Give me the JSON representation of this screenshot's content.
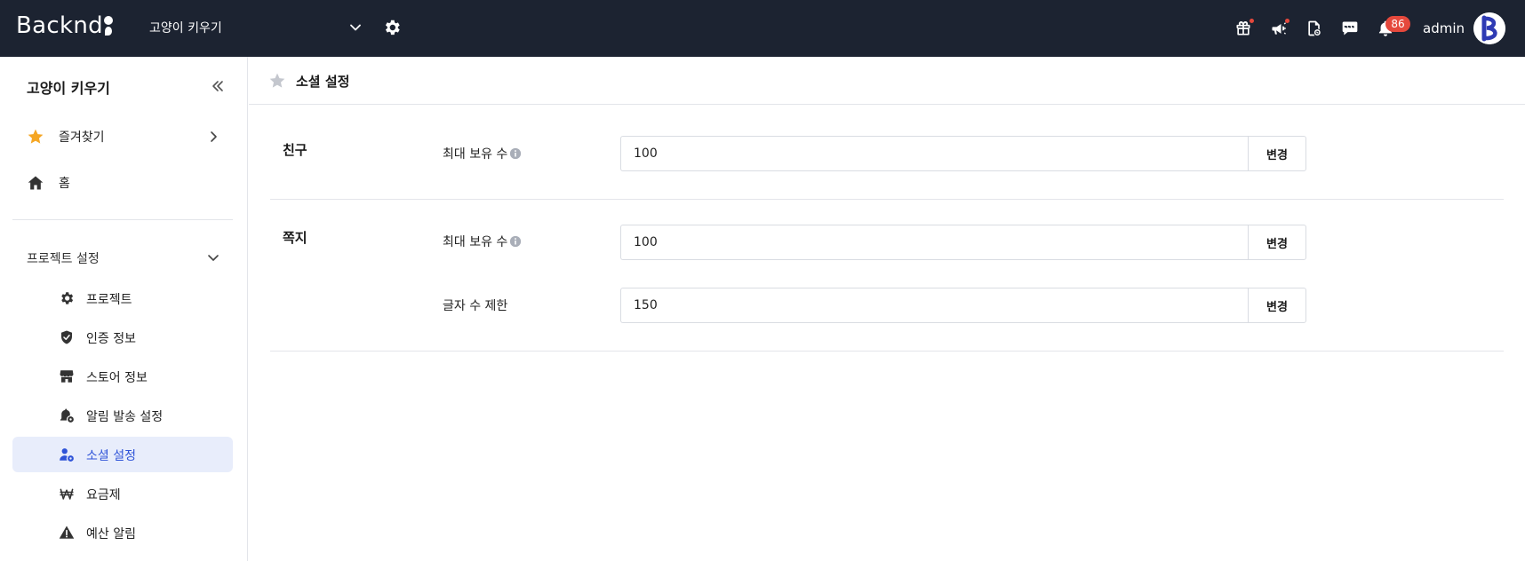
{
  "brand": {
    "name": "Backnd"
  },
  "topbar": {
    "project_name": "고양이 키우기",
    "notification_count": "86",
    "user_name": "admin"
  },
  "sidebar": {
    "title": "고양이 키우기",
    "favorites_label": "즐겨찾기",
    "home_label": "홈",
    "group_label": "프로젝트 설정",
    "items": [
      {
        "label": "프로젝트",
        "icon": "gear-icon"
      },
      {
        "label": "인증 정보",
        "icon": "shield-check-icon"
      },
      {
        "label": "스토어 정보",
        "icon": "store-icon"
      },
      {
        "label": "알림 발송 설정",
        "icon": "bell-gear-icon"
      },
      {
        "label": "소셜 설정",
        "icon": "user-gear-icon",
        "active": true
      },
      {
        "label": "요금제",
        "icon": "won-icon"
      },
      {
        "label": "예산 알림",
        "icon": "warning-icon"
      }
    ]
  },
  "page": {
    "title": "소셜 설정"
  },
  "sections": [
    {
      "title": "친구",
      "fields": [
        {
          "label": "최대 보유 수",
          "value": "100",
          "button": "변경",
          "has_info": true
        }
      ]
    },
    {
      "title": "쪽지",
      "fields": [
        {
          "label": "최대 보유 수",
          "value": "100",
          "button": "변경",
          "has_info": true
        },
        {
          "label": "글자 수 제한",
          "value": "150",
          "button": "변경",
          "has_info": false
        }
      ]
    }
  ],
  "colors": {
    "topbar_bg": "#1c2331",
    "accent": "#2f54d8",
    "active_bg": "#e8edfb",
    "favorite_star": "#f5a623",
    "badge_red": "#e5483c"
  }
}
